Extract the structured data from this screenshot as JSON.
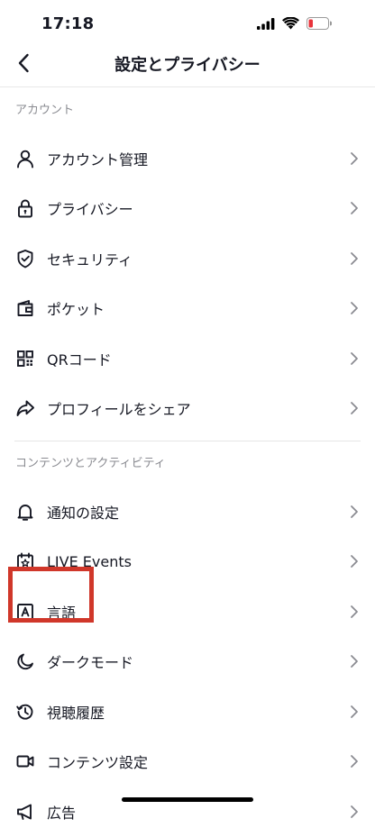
{
  "status_bar": {
    "time": "17:18",
    "icons": [
      "signal-icon",
      "wifi-icon",
      "battery-icon"
    ]
  },
  "nav": {
    "title": "設定とプライバシー",
    "back_icon": "chevron-left-icon"
  },
  "sections": [
    {
      "header": "アカウント",
      "items": [
        {
          "label": "アカウント管理",
          "icon": "person-icon"
        },
        {
          "label": "プライバシー",
          "icon": "lock-icon"
        },
        {
          "label": "セキュリティ",
          "icon": "shield-icon"
        },
        {
          "label": "ポケット",
          "icon": "wallet-icon"
        },
        {
          "label": "QRコード",
          "icon": "qr-code-icon"
        },
        {
          "label": "プロフィールをシェア",
          "icon": "share-icon"
        }
      ]
    },
    {
      "header": "コンテンツとアクティビティ",
      "items": [
        {
          "label": "通知の設定",
          "icon": "bell-icon"
        },
        {
          "label": "LIVE Events",
          "icon": "calendar-star-icon"
        },
        {
          "label": "言語",
          "icon": "language-icon"
        },
        {
          "label": "ダークモード",
          "icon": "moon-icon"
        },
        {
          "label": "視聴履歴",
          "icon": "history-icon"
        },
        {
          "label": "コンテンツ設定",
          "icon": "video-camera-icon"
        },
        {
          "label": "広告",
          "icon": "megaphone-icon"
        }
      ]
    }
  ],
  "colors": {
    "highlight": "#d0372a",
    "battery_low": "#e8333b",
    "text": "#161823",
    "muted": "#8a8b91"
  }
}
